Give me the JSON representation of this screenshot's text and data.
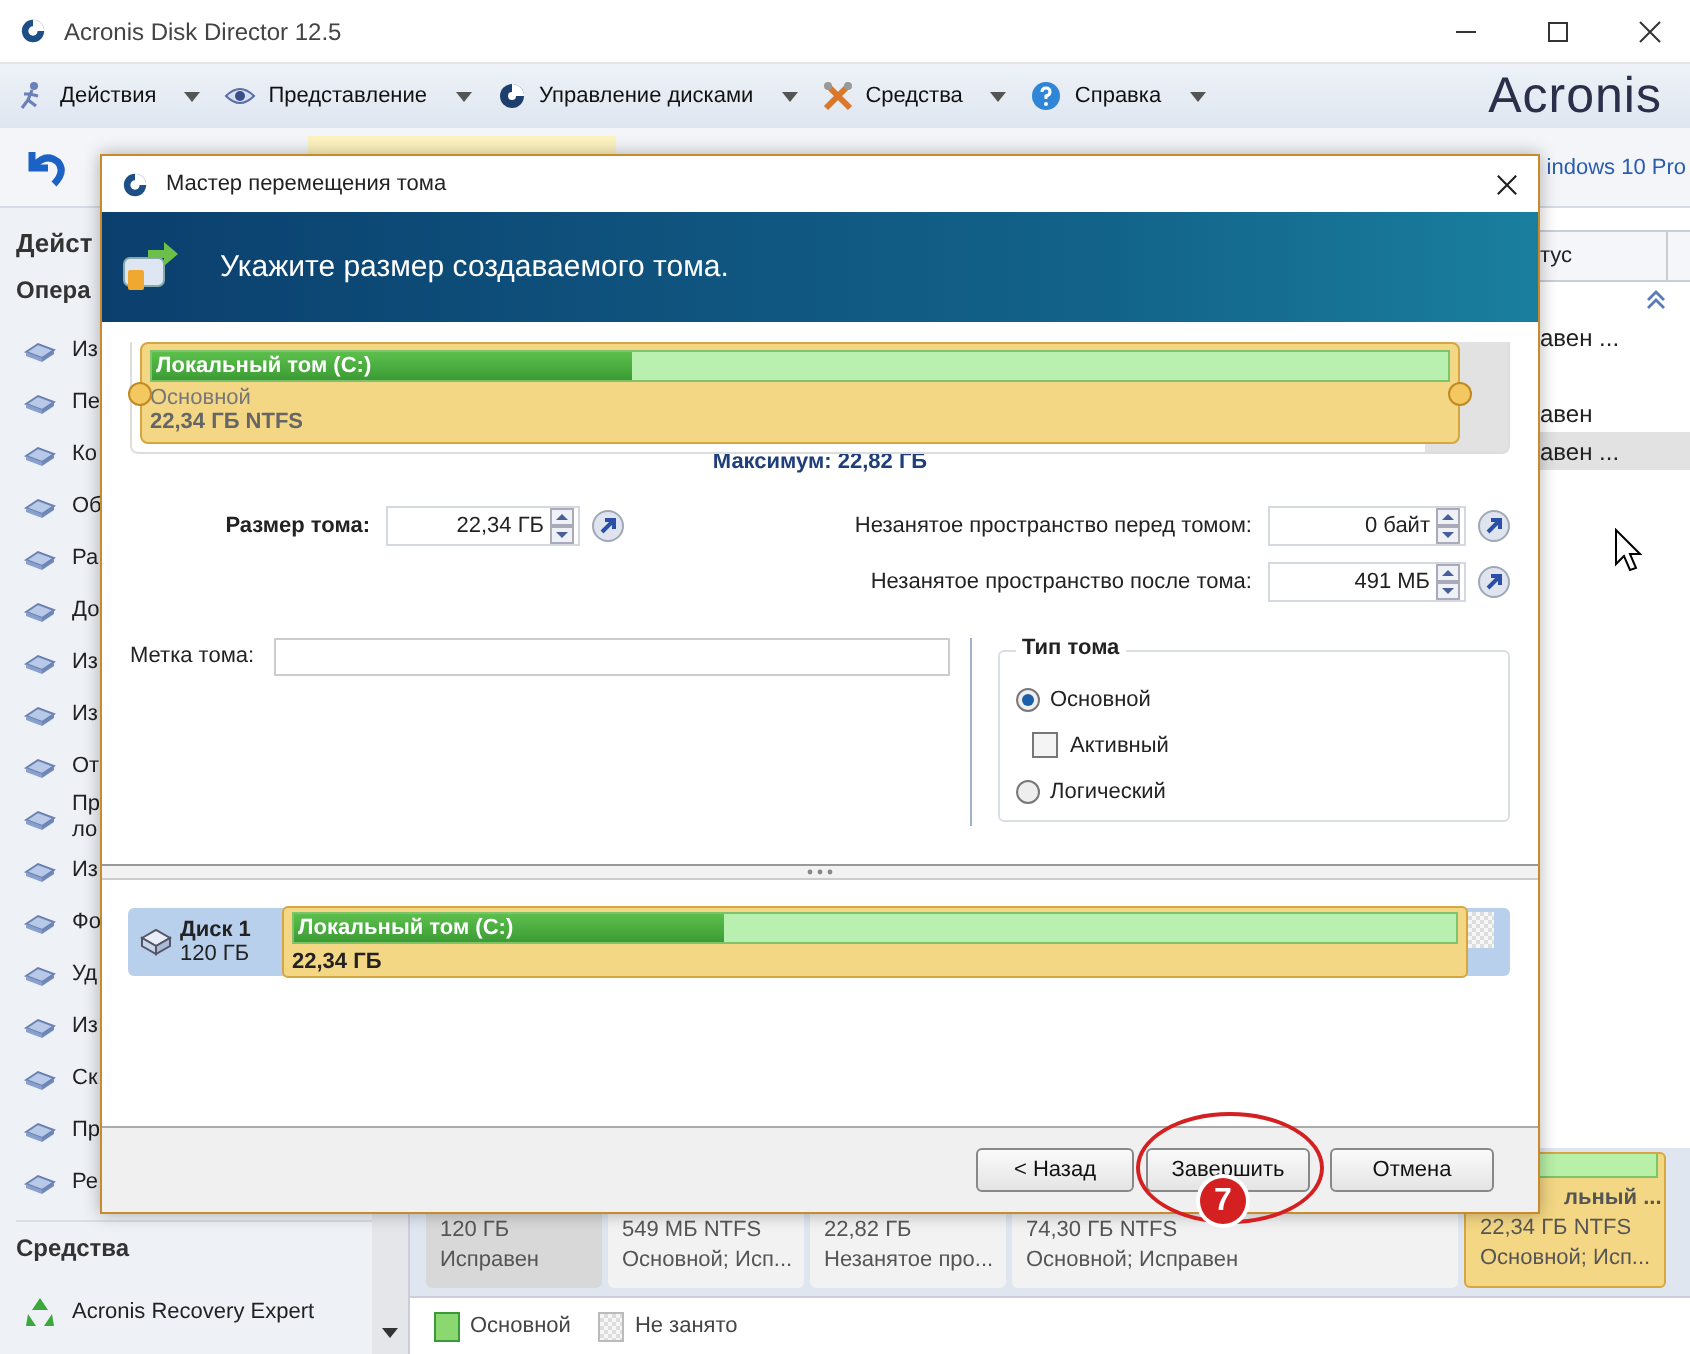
{
  "window": {
    "title": "Acronis Disk Director 12.5"
  },
  "menu": [
    {
      "kind": "actions",
      "label": "Действия"
    },
    {
      "kind": "view",
      "label": "Представление"
    },
    {
      "kind": "disks",
      "label": "Управление дисками"
    },
    {
      "kind": "tools",
      "label": "Средства"
    },
    {
      "kind": "help",
      "label": "Справка"
    }
  ],
  "brand": "Acronis",
  "toolbar": {
    "os_label": "indows 10 Pro"
  },
  "sidebar": {
    "title": "Дейст",
    "section": "Опера",
    "items": [
      "Из",
      "Пе",
      "Ко",
      "Об",
      "Ра",
      "До",
      "Из",
      "Из",
      "От",
      "Пр\nло",
      "Из",
      "Фо",
      "Уд",
      "Из",
      "Ск",
      "Пр",
      "Ре"
    ],
    "tools_title": "Средства",
    "tools": [
      "Acronis Recovery Expert"
    ]
  },
  "volume_table": {
    "column": "тус",
    "rows": [
      {
        "status": "авен ...",
        "selected": false
      },
      {
        "status": "авен",
        "selected": false
      },
      {
        "status": "авен ...",
        "selected": true
      }
    ]
  },
  "disk_map": {
    "partitions": [
      {
        "kind": "disk",
        "size": "120 ГБ",
        "status": "Исправен"
      },
      {
        "kind": "primary",
        "size": "549 МБ NTFS",
        "status": "Основной; Исп..."
      },
      {
        "kind": "unallocated",
        "size": "22,82 ГБ",
        "status": "Незанятое про..."
      },
      {
        "kind": "primary",
        "size": "74,30 ГБ NTFS",
        "status": "Основной; Исправен"
      },
      {
        "kind": "selected",
        "name": "льный ...",
        "size": "22,34 ГБ NTFS",
        "status": "Основной; Исп..."
      }
    ],
    "legend": [
      {
        "kind": "primary",
        "label": "Основной"
      },
      {
        "kind": "unallocated",
        "label": "Не занято"
      }
    ]
  },
  "dialog": {
    "title": "Мастер перемещения тома",
    "heading": "Укажите размер создаваемого тома.",
    "volume_bar": {
      "name": "Локальный том (C:)",
      "level": 0.37,
      "type": "Основной",
      "size": "22,34 ГБ NTFS"
    },
    "maximum": "Максимум: 22,82 ГБ",
    "size": {
      "label": "Размер тома:",
      "value": "22,34 ГБ"
    },
    "before": {
      "label": "Незанятое пространство перед томом:",
      "value": "0 байт"
    },
    "after": {
      "label": "Незанятое пространство после тома:",
      "value": "491 МБ"
    },
    "volume_label": {
      "label": "Метка тома:"
    },
    "volume_type": {
      "title": "Тип тома",
      "options": [
        {
          "kind": "radio",
          "label": "Основной",
          "selected": true
        },
        {
          "kind": "checkbox",
          "label": "Активный",
          "checked": false
        },
        {
          "kind": "radio",
          "label": "Логический",
          "selected": false
        }
      ]
    },
    "disk": {
      "name": "Диск 1",
      "size": "120 ГБ",
      "partition_name": "Локальный том (C:)",
      "partition_size": "22,34 ГБ",
      "level": 0.37
    },
    "buttons": [
      {
        "kind": "back",
        "label": "< Назад"
      },
      {
        "kind": "finish",
        "label": "Завершить"
      },
      {
        "kind": "cancel",
        "label": "Отмена"
      }
    ]
  },
  "annotation": {
    "number": "7"
  }
}
